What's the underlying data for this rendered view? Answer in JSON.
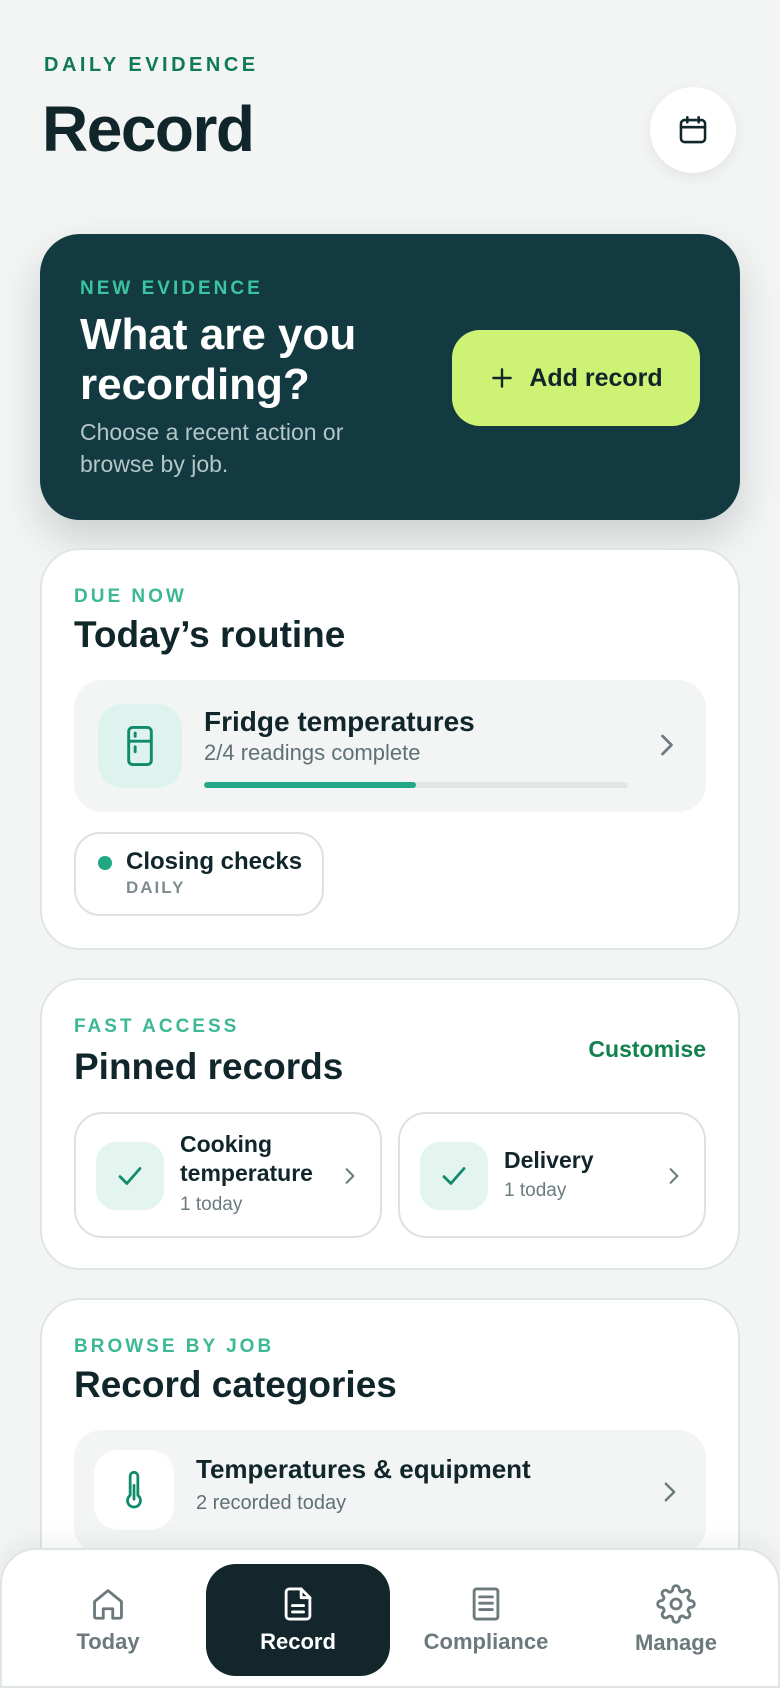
{
  "header": {
    "eyebrow": "DAILY EVIDENCE",
    "title": "Record",
    "calendar_icon": "calendar-icon"
  },
  "hero": {
    "eyebrow": "NEW EVIDENCE",
    "title": "What are you recording?",
    "subtitle": "Choose a recent action or browse by job.",
    "add_button_label": "Add record",
    "add_icon": "plus-icon"
  },
  "routine": {
    "eyebrow": "DUE NOW",
    "title": "Today’s routine",
    "item": {
      "name": "Fridge temperatures",
      "meta": "2/4 readings complete",
      "icon": "fridge-icon",
      "progress": 0.5
    },
    "chip": {
      "name": "Closing checks",
      "frequency": "DAILY"
    }
  },
  "pinned": {
    "eyebrow": "FAST ACCESS",
    "title": "Pinned records",
    "customise_label": "Customise",
    "items": [
      {
        "name": "Cooking temperature",
        "sub": "1 today",
        "icon": "check-icon"
      },
      {
        "name": "Delivery",
        "sub": "1 today",
        "icon": "check-icon"
      }
    ]
  },
  "categories": {
    "eyebrow": "BROWSE BY JOB",
    "title": "Record categories",
    "items": [
      {
        "name": "Temperatures & equipment",
        "sub": "2 recorded today",
        "icon": "thermometer-icon"
      }
    ]
  },
  "nav": {
    "items": [
      {
        "label": "Today",
        "icon": "home-icon",
        "active": false
      },
      {
        "label": "Record",
        "icon": "document-icon",
        "active": true
      },
      {
        "label": "Compliance",
        "icon": "book-icon",
        "active": false
      },
      {
        "label": "Manage",
        "icon": "gear-icon",
        "active": false
      }
    ]
  },
  "colors": {
    "background": "#f3f5f4",
    "hero": "#123a40",
    "accent_lime": "#cdf274",
    "accent_green": "#23a888",
    "text_dark": "#10262b",
    "nav_active": "#12262c"
  }
}
